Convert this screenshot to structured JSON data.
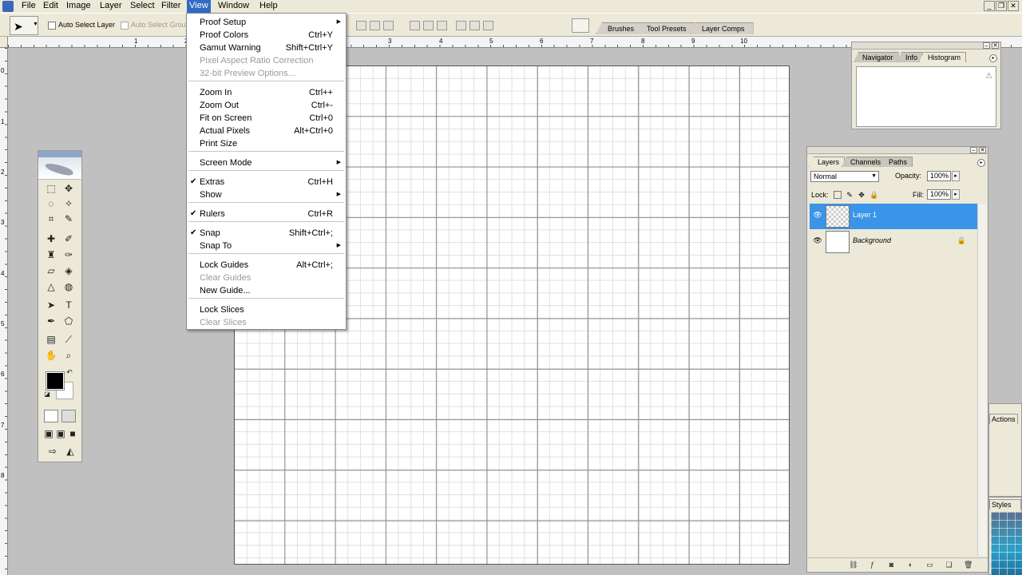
{
  "menubar": {
    "items": [
      "File",
      "Edit",
      "Image",
      "Layer",
      "Select",
      "Filter",
      "View",
      "Window",
      "Help"
    ],
    "active": "View"
  },
  "options": {
    "auto_select_layer": "Auto Select Layer",
    "auto_select_groups": "Auto Select Grou"
  },
  "palette_well": {
    "tabs": [
      "Brushes",
      "Tool Presets",
      "Layer Comps"
    ]
  },
  "rulers": {
    "top_labels": [
      "1",
      "2",
      "3",
      "4",
      "5",
      "6",
      "7",
      "8",
      "9",
      "10"
    ],
    "left_labels": [
      "0",
      "1",
      "2",
      "3",
      "4",
      "5",
      "6",
      "7",
      "8"
    ]
  },
  "view_menu": {
    "items": [
      {
        "label": "Proof Setup",
        "shortcut": "",
        "submenu": true
      },
      {
        "label": "Proof Colors",
        "shortcut": "Ctrl+Y"
      },
      {
        "label": "Gamut Warning",
        "shortcut": "Shift+Ctrl+Y"
      },
      {
        "label": "Pixel Aspect Ratio Correction",
        "shortcut": "",
        "disabled": true
      },
      {
        "label": "32-bit Preview Options...",
        "shortcut": "",
        "disabled": true
      },
      {
        "label": "Zoom In",
        "shortcut": "Ctrl++"
      },
      {
        "label": "Zoom Out",
        "shortcut": "Ctrl+-"
      },
      {
        "label": "Fit on Screen",
        "shortcut": "Ctrl+0"
      },
      {
        "label": "Actual Pixels",
        "shortcut": "Alt+Ctrl+0"
      },
      {
        "label": "Print Size",
        "shortcut": ""
      },
      {
        "label": "Screen Mode",
        "shortcut": "",
        "submenu": true
      },
      {
        "label": "Extras",
        "shortcut": "Ctrl+H",
        "checked": true
      },
      {
        "label": "Show",
        "shortcut": "",
        "submenu": true
      },
      {
        "label": "Rulers",
        "shortcut": "Ctrl+R",
        "checked": true
      },
      {
        "label": "Snap",
        "shortcut": "Shift+Ctrl+;",
        "checked": true
      },
      {
        "label": "Snap To",
        "shortcut": "",
        "submenu": true
      },
      {
        "label": "Lock Guides",
        "shortcut": "Alt+Ctrl+;"
      },
      {
        "label": "Clear Guides",
        "shortcut": "",
        "disabled": true
      },
      {
        "label": "New Guide...",
        "shortcut": ""
      },
      {
        "label": "Lock Slices",
        "shortcut": ""
      },
      {
        "label": "Clear Slices",
        "shortcut": "",
        "disabled": true
      }
    ]
  },
  "histogram_panel": {
    "tabs": [
      "Navigator",
      "Info",
      "Histogram"
    ],
    "active_tab": "Histogram"
  },
  "layers_panel": {
    "tabs": [
      "Layers",
      "Channels",
      "Paths"
    ],
    "active_tab": "Layers",
    "blend_mode": "Normal",
    "opacity_label": "Opacity:",
    "opacity": "100%",
    "lock_label": "Lock:",
    "fill_label": "Fill:",
    "fill": "100%",
    "layers": [
      {
        "name": "Layer 1",
        "selected": true
      },
      {
        "name": "Background",
        "selected": false,
        "locked": true
      }
    ]
  },
  "actions_panel": {
    "tab": "Actions"
  },
  "styles_panel": {
    "tab": "Styles"
  },
  "colors": {
    "menu_highlight": "#316ac5",
    "layer_selected": "#3a95e8",
    "chrome": "#ece9d8"
  }
}
